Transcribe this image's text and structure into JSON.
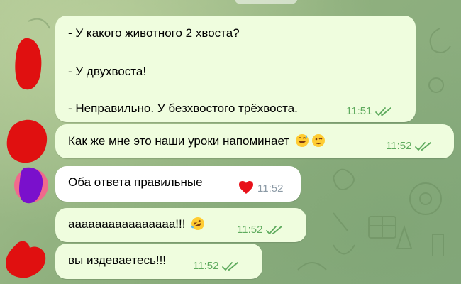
{
  "messages": [
    {
      "lines": [
        "- У какого животного 2 хвоста?",
        "",
        "- У двухвоста!",
        "",
        "- Неправильно. У безхвостого трёхвоста."
      ],
      "time": "11:51"
    },
    {
      "text": "Как же мне это наши уроки напоминает",
      "time": "11:52",
      "emojis": [
        "sweat-smile-emoji",
        "wink-emoji"
      ]
    },
    {
      "text": "Оба ответа правильные",
      "time": "11:52",
      "reaction": "heart-reaction-icon"
    },
    {
      "text": "аааааааааааааааа!!!",
      "time": "11:52",
      "emojis": [
        "rofl-emoji"
      ]
    },
    {
      "text": "вы издеваетесь!!!",
      "time": "11:52"
    }
  ],
  "colors": {
    "bubble": "#effdde",
    "time_outgoing": "#5fab5e",
    "time_incoming": "#8c9aa6",
    "avatar_red": "#e01010",
    "avatar_purple": "#7a10cc"
  }
}
